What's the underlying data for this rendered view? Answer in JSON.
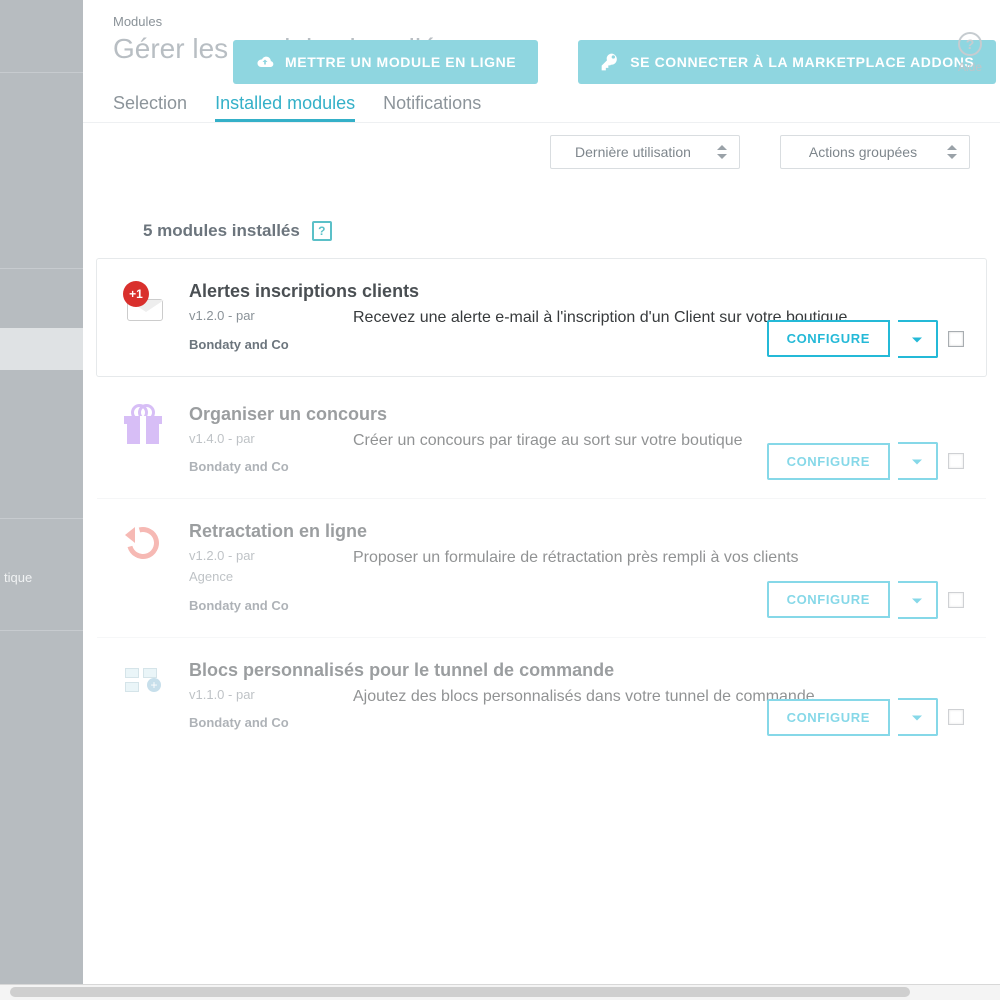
{
  "breadcrumb": "Modules",
  "page_title": "Gérer les modules installés",
  "top_buttons": {
    "upload": "METTRE UN MODULE EN LIGNE",
    "connect": "SE CONNECTER À LA MARKETPLACE ADDONS"
  },
  "help_label": "Aide",
  "tabs": {
    "selection": "Selection",
    "installed": "Installed modules",
    "notifications": "Notifications"
  },
  "filters": {
    "sort": "Dernière utilisation",
    "bulk": "Actions groupées"
  },
  "count_label": "5 modules installés",
  "configure_label": "CONFIGURE",
  "sidebar_label": "tique",
  "modules": [
    {
      "title": "Alertes inscriptions clients",
      "version": "v1.2.0 - par",
      "author": "Bondaty and Co",
      "desc": "Recevez une alerte e-mail à l'inscription d'un Client sur votre boutique"
    },
    {
      "title": "Organiser un concours",
      "version": "v1.4.0 - par",
      "author": "Bondaty and Co",
      "desc": "Créer un concours par tirage au sort sur votre boutique"
    },
    {
      "title": "Retractation en ligne",
      "version": "v1.2.0 - par",
      "author_line1": "Agence",
      "author": "Bondaty and Co",
      "desc": "Proposer un formulaire de rétractation près rempli à vos clients"
    },
    {
      "title": "Blocs personnalisés pour le tunnel de commande",
      "version": "v1.1.0 - par",
      "author": "Bondaty and Co",
      "desc": "Ajoutez des blocs personnalisés dans votre tunnel de commande"
    }
  ]
}
